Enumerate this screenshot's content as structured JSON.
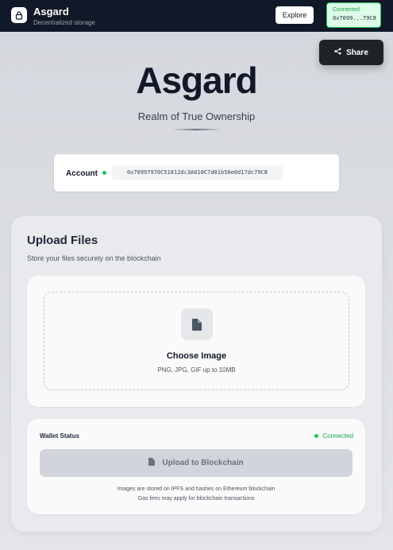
{
  "header": {
    "app_name": "Asgard",
    "tagline": "Decentralized storage",
    "explore_label": "Explore",
    "connection_status": "Connected",
    "short_address": "0x7099...79C8"
  },
  "share": {
    "label": "Share"
  },
  "hero": {
    "title": "Asgard",
    "subtitle": "Realm of True Ownership"
  },
  "account": {
    "label": "Account",
    "address": "0x70997970C51812dc3A010C7d01b50e0d17dc79C8"
  },
  "upload": {
    "title": "Upload Files",
    "subtitle": "Store your files securely on the blockchain",
    "choose_label": "Choose Image",
    "choose_hint": "PNG, JPG, GIF up to 10MB"
  },
  "wallet": {
    "label": "Wallet Status",
    "status": "Connected",
    "upload_button": "Upload to Blockchain",
    "note_line1": "Images are stored on IPFS and hashes on Ethereum blockchain",
    "note_line2": "Gas fees may apply for blockchain transactions"
  },
  "colors": {
    "topbar": "#111827",
    "accent_green": "#22c55e",
    "disabled_button": "#d1d5db"
  },
  "icons": {
    "logo": "lock-icon",
    "share": "share-icon",
    "file": "file-icon"
  }
}
